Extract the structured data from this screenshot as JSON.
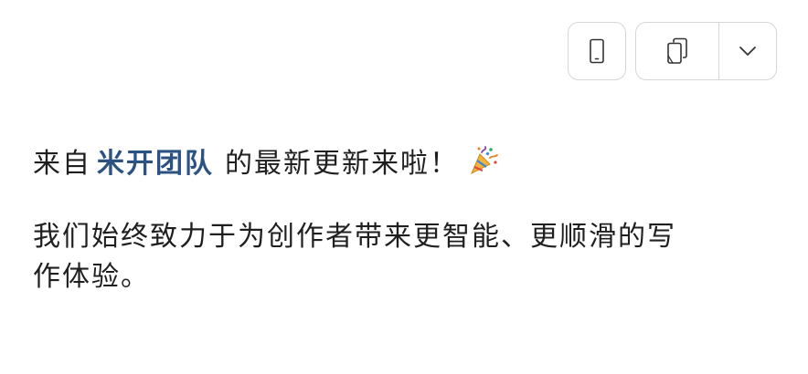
{
  "toolbar": {
    "mobile_icon": "mobile-phone-icon",
    "copy_icon": "copy-icon",
    "more_icon": "chevron-down-icon"
  },
  "message": {
    "line1_prefix": "来自",
    "team_name": "米开团队",
    "line1_suffix": "的最新更新来啦！",
    "emoji_icon": "party-popper-icon",
    "paragraph2": "我们始终致力于为创作者带来更智能、更顺滑的写作体验。"
  },
  "colors": {
    "accent": "#2c5282",
    "border": "#d6d6d6",
    "text": "#1f1f1f"
  }
}
